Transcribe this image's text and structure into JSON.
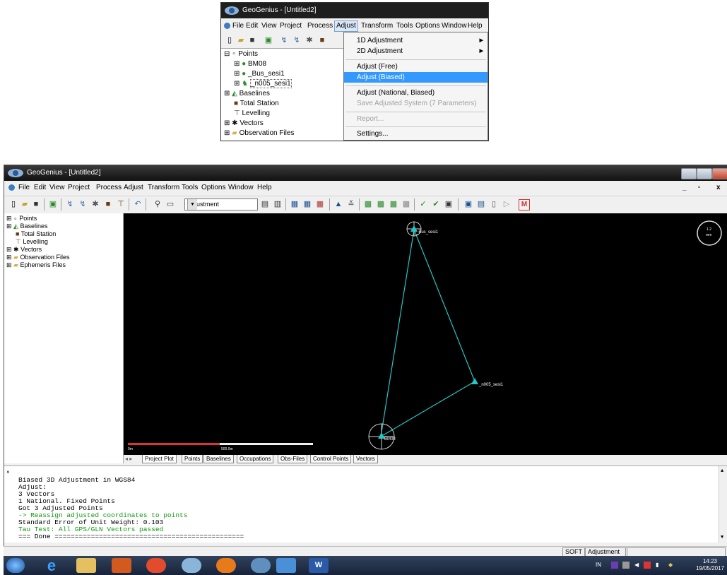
{
  "inset": {
    "window_title": "GeoGenius - [Untitled2]",
    "menu": [
      "File",
      "Edit",
      "View",
      "Project",
      "Process",
      "Adjust",
      "Transform",
      "Tools",
      "Options",
      "Window",
      "Help"
    ],
    "tree": {
      "points": "Points",
      "point_items": [
        "BM08",
        "_Bus_sesi1",
        "_n005_sesi1"
      ],
      "baselines": "Baselines",
      "total_station": "Total Station",
      "levelling": "Levelling",
      "vectors": "Vectors",
      "observation_files": "Observation Files"
    },
    "dropdown": {
      "items": [
        {
          "label": "1D Adjustment",
          "submenu": true
        },
        {
          "label": "2D Adjustment",
          "submenu": true
        },
        {
          "label": "Adjust (Free)"
        },
        {
          "label": "Adjust (Biased)",
          "selected": true
        },
        {
          "label": "Adjust (National, Biased)"
        },
        {
          "label": "Save Adjusted System (7 Parameters)",
          "disabled": true
        },
        {
          "label": "Report...",
          "disabled": true
        },
        {
          "label": "Settings..."
        }
      ]
    }
  },
  "main": {
    "window_title": "GeoGenius - [Untitled2]",
    "menu": [
      "File",
      "Edit",
      "View",
      "Project",
      "Process",
      "Adjust",
      "Transform",
      "Tools",
      "Options",
      "Window",
      "Help"
    ],
    "toolbar": {
      "combo_value": "Adjustment"
    },
    "tree": {
      "points": "Points",
      "baselines": "Baselines",
      "total_station": "Total Station",
      "levelling": "Levelling",
      "vectors": "Vectors",
      "observation_files": "Observation Files",
      "ephemeris_files": "Ephemeris Files"
    },
    "plot": {
      "points": [
        {
          "name": "_Bus_sesi1"
        },
        {
          "name": "_n005_sesi1"
        },
        {
          "name": "BM08"
        }
      ],
      "scale_start": "0m",
      "scale_end": "500.0m",
      "compass_top": "1.2",
      "compass_bottom": "mm"
    },
    "tabs": [
      "Project Plot",
      "Points",
      "Baselines",
      "Occupations",
      "Obs-Files",
      "Control Points",
      "Vectors"
    ],
    "output": {
      "lines": [
        {
          "text": "Biased 3D Adjustment in WGS84",
          "color": "#000000"
        },
        {
          "text": "Adjust:",
          "color": "#000000"
        },
        {
          "text": "3 Vectors",
          "color": "#000000"
        },
        {
          "text": "1 National. Fixed Points",
          "color": "#000000"
        },
        {
          "text": "Got 3 Adjusted Points",
          "color": "#000000"
        },
        {
          "text": "-> Reassign adjusted coordinates to points",
          "color": "#119911"
        },
        {
          "text": "Standard Error of Unit Weight: 0.103",
          "color": "#000000"
        },
        {
          "text": "Tau Test: All GPS/GLN Vectors passed",
          "color": "#119911"
        },
        {
          "text": "=== Done ===============================================",
          "color": "#000000"
        }
      ]
    },
    "statusbar": {
      "mode": "SOFT",
      "state": "Adjustment"
    }
  },
  "taskbar": {
    "lang": "IN",
    "time": "14:23",
    "date": "19/05/2017"
  },
  "colors": {
    "vector_line": "#26c6c6",
    "plot_bg": "#000000",
    "selection": "#3399ff"
  }
}
